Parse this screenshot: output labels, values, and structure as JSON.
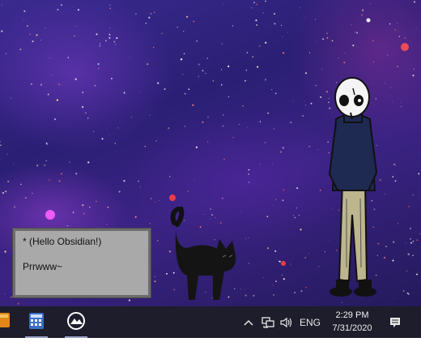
{
  "desktop": {
    "background": "starfield-space-wallpaper"
  },
  "dialog": {
    "line1": "* (Hello Obsidian!)",
    "line2": "Prrwww~"
  },
  "taskbar": {
    "apps": [
      {
        "name": "folder-app-icon",
        "color": "#f0a030"
      },
      {
        "name": "calculator-app-icon",
        "color": "#3a8ad8"
      },
      {
        "name": "photo-app-icon",
        "color": "#ffffff"
      }
    ],
    "tray": {
      "chevron": "^",
      "language": "ENG"
    },
    "clock": {
      "time": "2:29 PM",
      "date": "7/31/2020"
    }
  }
}
